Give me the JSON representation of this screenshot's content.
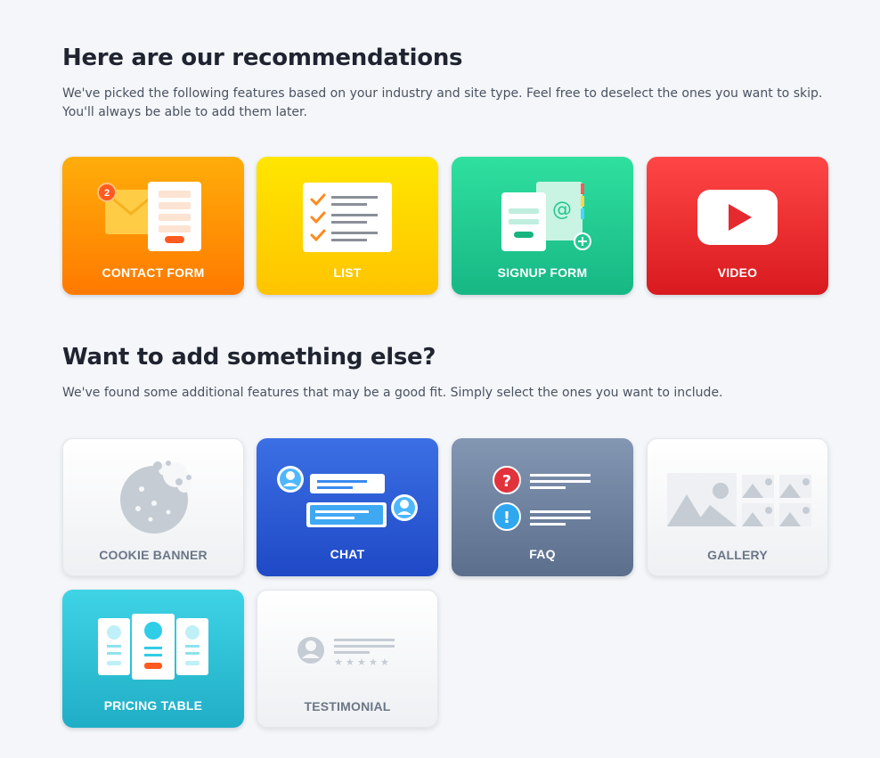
{
  "recommendations": {
    "title": "Here are our recommendations",
    "subtitle": "We've picked the following features based on your industry and site type. Feel free to deselect the ones you want to skip. You'll always be able to add them later.",
    "cards": [
      {
        "label": "CONTACT FORM",
        "icon": "envelope-form-icon",
        "badge": "2",
        "color": "#ff8c00"
      },
      {
        "label": "LIST",
        "icon": "checklist-icon",
        "color": "#ffd400"
      },
      {
        "label": "SIGNUP FORM",
        "icon": "signup-form-icon",
        "color": "#22c98f"
      },
      {
        "label": "VIDEO",
        "icon": "play-button-icon",
        "color": "#e52a2f"
      }
    ]
  },
  "additional": {
    "title": "Want to add something else?",
    "subtitle": "We've found some additional features that may be a good fit. Simply select the ones you want to include.",
    "cards": [
      {
        "label": "COOKIE BANNER",
        "icon": "cookie-icon",
        "color": "#ffffff"
      },
      {
        "label": "CHAT",
        "icon": "chat-bubbles-icon",
        "color": "#2b5bd6"
      },
      {
        "label": "FAQ",
        "icon": "faq-icon",
        "color": "#6e82a0"
      },
      {
        "label": "GALLERY",
        "icon": "gallery-icon",
        "color": "#ffffff"
      },
      {
        "label": "PRICING TABLE",
        "icon": "pricing-table-icon",
        "color": "#2fc2d8"
      },
      {
        "label": "TESTIMONIAL",
        "icon": "testimonial-icon",
        "color": "#ffffff"
      }
    ]
  }
}
